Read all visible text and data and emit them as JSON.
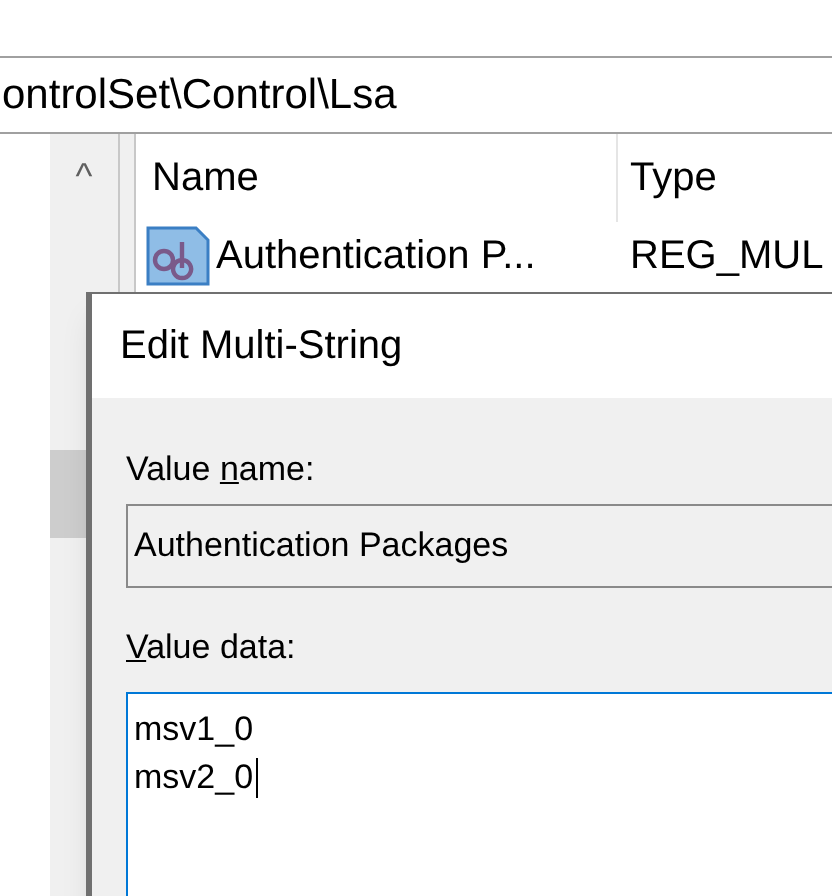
{
  "address_bar": {
    "path": "ontrolSet\\Control\\Lsa"
  },
  "tree_pane": {
    "scroll_up": "^"
  },
  "list": {
    "columns": [
      "Name",
      "Type"
    ],
    "rows": [
      {
        "name": "Authentication P...",
        "type": "REG_MUL"
      }
    ]
  },
  "dialog": {
    "title": "Edit Multi-String",
    "value_name": {
      "label_parts": [
        {
          "text": "Value ",
          "underline": false
        },
        {
          "text": "n",
          "underline": true
        },
        {
          "text": "ame:",
          "underline": false
        }
      ],
      "value": "Authentication Packages"
    },
    "value_data": {
      "label_parts": [
        {
          "text": "V",
          "underline": true
        },
        {
          "text": "alue data:",
          "underline": false
        }
      ],
      "lines": [
        "msv1_0",
        "msv2_0"
      ],
      "focused": true
    }
  }
}
